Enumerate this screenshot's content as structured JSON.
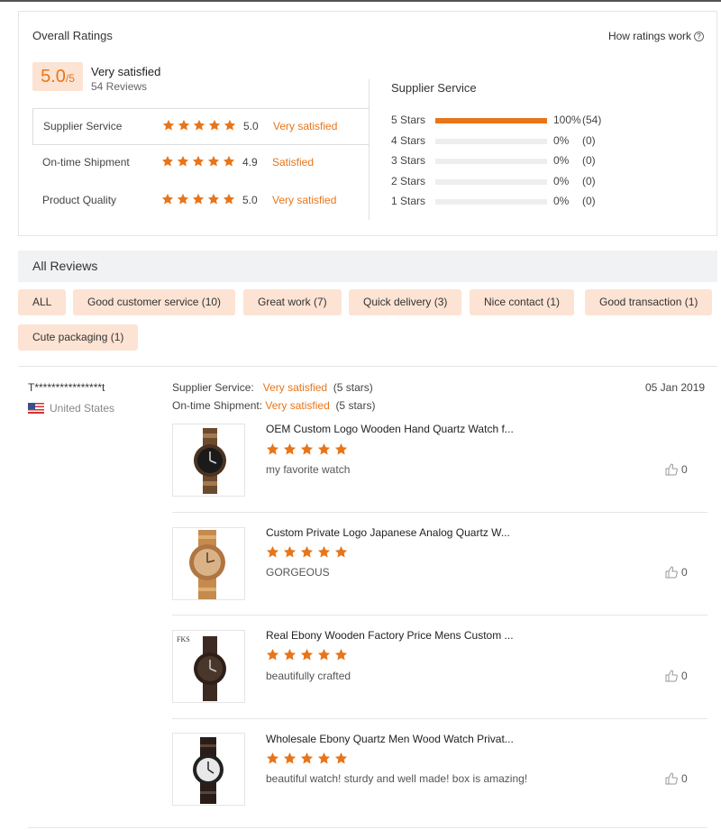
{
  "overall": {
    "title": "Overall Ratings",
    "how_link": "How ratings work",
    "score": "5.0",
    "score_max": "/5",
    "summary_label": "Very satisfied",
    "review_count": "54 Reviews",
    "rows": [
      {
        "label": "Supplier Service",
        "value": "5.0",
        "text": "Very satisfied",
        "stars": 5
      },
      {
        "label": "On-time Shipment",
        "value": "4.9",
        "text": "Satisfied",
        "stars": 5
      },
      {
        "label": "Product Quality",
        "value": "5.0",
        "text": "Very satisfied",
        "stars": 5
      }
    ],
    "breakdown_title": "Supplier Service",
    "breakdown": [
      {
        "label": "5 Stars",
        "pct": "100%",
        "count": "(54)",
        "fraction": 1.0
      },
      {
        "label": "4 Stars",
        "pct": "0%",
        "count": "(0)",
        "fraction": 0
      },
      {
        "label": "3 Stars",
        "pct": "0%",
        "count": "(0)",
        "fraction": 0
      },
      {
        "label": "2 Stars",
        "pct": "0%",
        "count": "(0)",
        "fraction": 0
      },
      {
        "label": "1 Stars",
        "pct": "0%",
        "count": "(0)",
        "fraction": 0
      }
    ]
  },
  "all_reviews": {
    "title": "All Reviews",
    "tags": [
      "ALL",
      "Good customer service (10)",
      "Great work (7)",
      "Quick delivery (3)",
      "Nice contact (1)",
      "Good transaction (1)",
      "Cute packaging (1)"
    ]
  },
  "review": {
    "user": "T****************t",
    "country": "United States",
    "date": "05 Jan 2019",
    "supplier_label": "Supplier Service:",
    "supplier_value": "Very satisfied",
    "supplier_stars": "(5 stars)",
    "shipment_label": "On-time Shipment:",
    "shipment_value": "Very satisfied",
    "shipment_stars": "(5 stars)",
    "products": [
      {
        "title": "OEM Custom Logo Wooden Hand Quartz Watch f...",
        "comment": "my favorite watch",
        "likes": "0",
        "stars": 5
      },
      {
        "title": "Custom Private Logo Japanese Analog Quartz W...",
        "comment": "GORGEOUS",
        "likes": "0",
        "stars": 5
      },
      {
        "title": "Real Ebony Wooden Factory Price Mens Custom ...",
        "comment": "beautifully crafted",
        "likes": "0",
        "stars": 5,
        "img_label": "FKS"
      },
      {
        "title": "Wholesale Ebony Quartz Men Wood Watch Privat...",
        "comment": "beautiful watch! sturdy and well made! box is amazing!",
        "likes": "0",
        "stars": 5
      }
    ]
  },
  "colors": {
    "accent": "#e8751a",
    "tag_bg": "#fde3d3",
    "header_bg": "#f0f2f4"
  }
}
